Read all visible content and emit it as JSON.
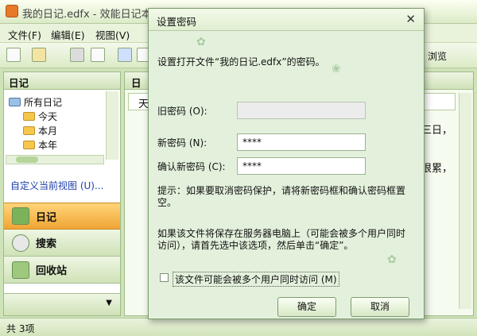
{
  "window": {
    "title": "我的日记.edfx - 效能日记本专业版 - 日记"
  },
  "menu": [
    "文件(F)",
    "编辑(E)",
    "视图(V)"
  ],
  "toolbar": {
    "right_label": "浏览"
  },
  "left_panel": {
    "header": "日记",
    "tree": [
      "所有日记",
      "今天",
      "本月",
      "本年"
    ],
    "custom_view_link": "自定义当前视图 (U)...",
    "nav": [
      {
        "label": "日记"
      },
      {
        "label": "搜索"
      },
      {
        "label": "回收站"
      }
    ]
  },
  "right_panel": {
    "header": "日",
    "column": "天",
    "row1_tail": "三日，",
    "row2_tail": "很累，"
  },
  "statusbar": {
    "text": "共 3项"
  },
  "dialog": {
    "title": "设置密码",
    "description": "设置打开文件“我的日记.edfx”的密码。",
    "old_password_label": "旧密码 (O):",
    "old_password_value": "",
    "new_password_label": "新密码 (N):",
    "new_password_value": "****",
    "confirm_label": "确认新密码 (C):",
    "confirm_value": "****",
    "hint": "提示：如果要取消密码保护，请将新密码框和确认密码框置空。",
    "server_note": "如果该文件将保存在服务器电脑上（可能会被多个用户同时访问），请首先选中该选项，然后单击“确定”。",
    "checkbox_label": "该文件可能会被多个用户同时访问 (M)",
    "checkbox_checked": false,
    "ok_label": "确定",
    "cancel_label": "取消"
  }
}
